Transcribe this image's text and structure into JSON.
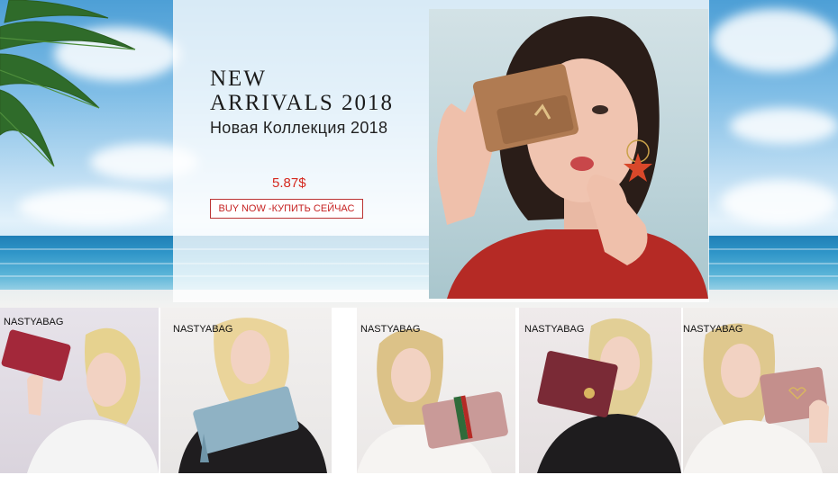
{
  "promo": {
    "title_line1": "NEW",
    "title_line2": "ARRIVALS 2018",
    "subtitle": "Новая Коллекция 2018",
    "price": "5.87$",
    "buy_button": "BUY NOW -КУПИТЬ СЕЙЧАС"
  },
  "thumbnails": [
    {
      "brand": "NASTYABAG",
      "wallet_color": "#a3283a"
    },
    {
      "brand": "NASTYABAG",
      "wallet_color": "#8fb2c4"
    },
    {
      "brand": "NASTYABAG",
      "wallet_color": "#c99a98"
    },
    {
      "brand": "NASTYABAG",
      "wallet_color": "#7a2a36"
    },
    {
      "brand": "NASTYABAG",
      "wallet_color": "#c48f8c"
    }
  ],
  "colors": {
    "price_red": "#d5281f",
    "button_border": "#bb3333",
    "hero_wallet": "#b07b52"
  }
}
